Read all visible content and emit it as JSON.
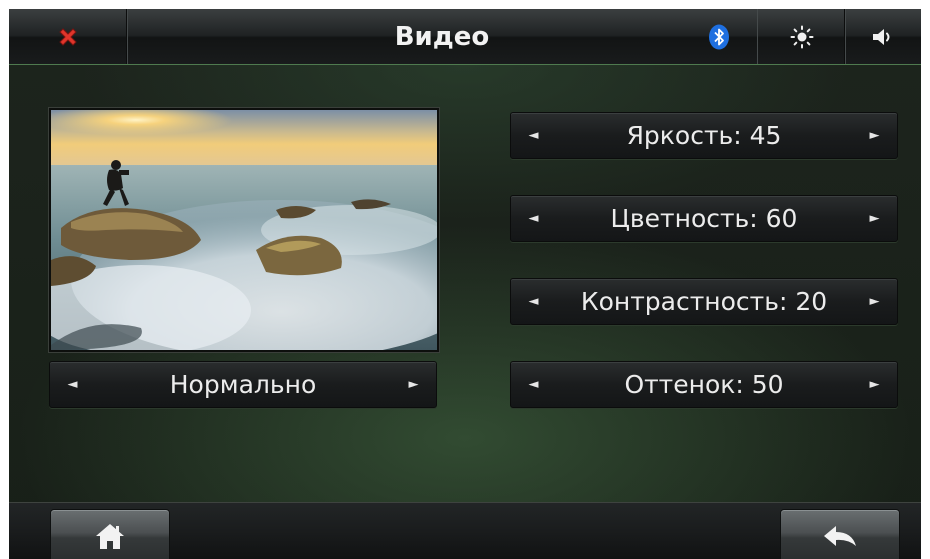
{
  "header": {
    "title": "Видео",
    "close_icon": "close-x-icon",
    "status_icon": "bluetooth-icon",
    "brightness_icon": "sun-icon",
    "volume_icon": "speaker-icon"
  },
  "preview": {
    "description_icon": "preview-image"
  },
  "mode_selector": {
    "value": "Нормально"
  },
  "settings": [
    {
      "label": "Яркость: 45"
    },
    {
      "label": "Цветность: 60"
    },
    {
      "label": "Контрастность: 20"
    },
    {
      "label": "Оттенок: 50"
    }
  ],
  "arrows": {
    "left": "◄",
    "right": "►"
  },
  "footer": {
    "home_icon": "home-icon",
    "back_icon": "back-arrow-icon"
  },
  "colors": {
    "close_red": "#e0352b",
    "bluetooth_blue": "#1e6fe0",
    "accent_green": "#4f7a4f"
  }
}
